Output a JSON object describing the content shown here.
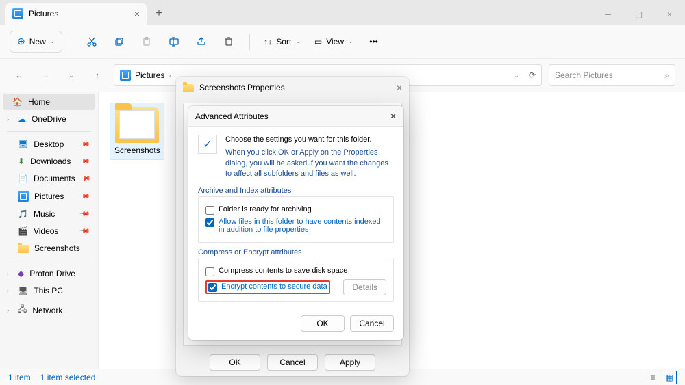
{
  "tab": {
    "title": "Pictures"
  },
  "toolbar": {
    "new": "New",
    "sort": "Sort",
    "view": "View"
  },
  "address": {
    "crumb": "Pictures"
  },
  "search": {
    "placeholder": "Search Pictures"
  },
  "sidebar": {
    "home": "Home",
    "onedrive": "OneDrive",
    "desktop": "Desktop",
    "downloads": "Downloads",
    "documents": "Documents",
    "pictures": "Pictures",
    "music": "Music",
    "videos": "Videos",
    "screenshots": "Screenshots",
    "proton": "Proton Drive",
    "thispc": "This PC",
    "network": "Network"
  },
  "folder": {
    "name": "Screenshots"
  },
  "status": {
    "items": "1 item",
    "selected": "1 item selected"
  },
  "propdlg": {
    "title": "Screenshots Properties",
    "ok": "OK",
    "cancel": "Cancel",
    "apply": "Apply"
  },
  "advdlg": {
    "title": "Advanced Attributes",
    "intro1": "Choose the settings you want for this folder.",
    "intro2": "When you click OK or Apply on the Properties dialog, you will be asked if you want the changes to affect all subfolders and files as well.",
    "group1": "Archive and Index attributes",
    "chk_archive": "Folder is ready for archiving",
    "chk_index": "Allow files in this folder to have contents indexed in addition to file properties",
    "group2": "Compress or Encrypt attributes",
    "chk_compress": "Compress contents to save disk space",
    "chk_encrypt": "Encrypt contents to secure data",
    "details": "Details",
    "ok": "OK",
    "cancel": "Cancel"
  }
}
